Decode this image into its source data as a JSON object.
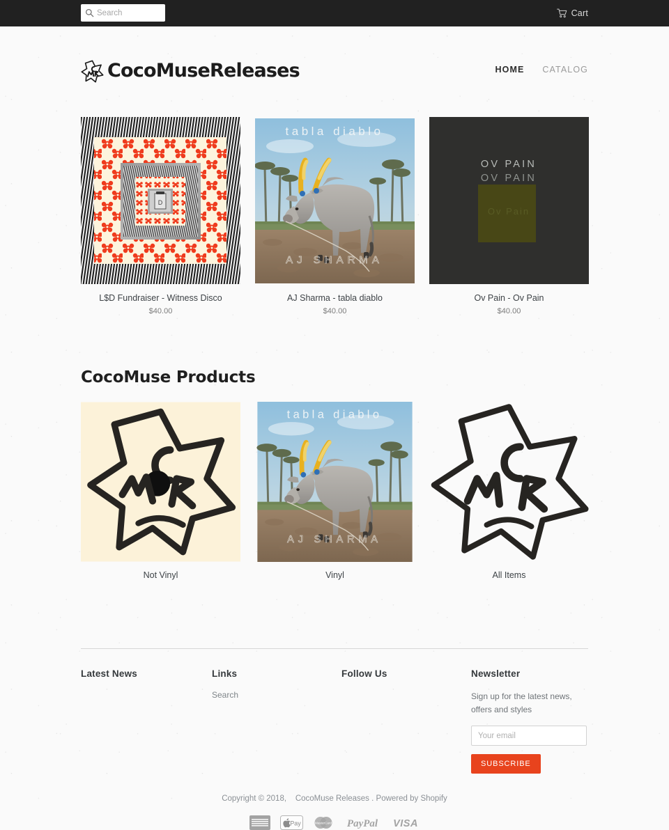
{
  "topbar": {
    "search": {
      "placeholder": "Search",
      "value": "",
      "icon": "search-icon"
    },
    "cart": {
      "label": "Cart",
      "icon": "shopping-cart-icon"
    }
  },
  "header": {
    "logo_text": "CocoMuseReleases",
    "logo_mark": "cmr-star-logo",
    "nav": [
      {
        "label": "HOME",
        "active": true
      },
      {
        "label": "CATALOG",
        "active": false
      }
    ]
  },
  "products": [
    {
      "title": "L$D Fundraiser - Witness Disco",
      "price": "$40.00",
      "art": "recursive-red-flowers-op-art-cover"
    },
    {
      "title": "AJ Sharma - tabla diablo",
      "price": "$40.00",
      "art": "zebu-cow-field-cover",
      "art_top_text": "tabla diablo",
      "art_bottom_text": "AJ SHARMA"
    },
    {
      "title": "Ov Pain - Ov Pain",
      "price": "$40.00",
      "art": "dark-olive-square-cover",
      "art_line1": "OV PAIN",
      "art_line2": "OV PAIN"
    }
  ],
  "collections_section": {
    "title": "CocoMuse Products",
    "items": [
      {
        "label": "Not Vinyl",
        "art": "cmr-star-logo-cream"
      },
      {
        "label": "Vinyl",
        "art": "zebu-cow-field-cover"
      },
      {
        "label": "All Items",
        "art": "cmr-star-logo-plain"
      }
    ]
  },
  "footer": {
    "columns": [
      {
        "heading": "Latest News",
        "links": []
      },
      {
        "heading": "Links",
        "links": [
          "Search"
        ]
      },
      {
        "heading": "Follow Us",
        "links": []
      }
    ],
    "newsletter": {
      "heading": "Newsletter",
      "text": "Sign up for the latest news, offers and styles",
      "email_placeholder": "Your email",
      "email_value": "",
      "button_label": "SUBSCRIBE",
      "button_color": "#e8431d"
    },
    "copyright": {
      "prefix": "Copyright © 2018,",
      "shop_name": "CocoMuse Releases",
      "suffix": ". Powered by Shopify"
    },
    "payment_icons": [
      "american-express-icon",
      "apple-pay-icon",
      "mastercard-icon",
      "paypal-icon",
      "visa-icon"
    ]
  },
  "colors": {
    "topbar_bg": "#212121",
    "page_bg": "#fafafa",
    "accent": "#e8431d",
    "text": "#3d4246"
  }
}
